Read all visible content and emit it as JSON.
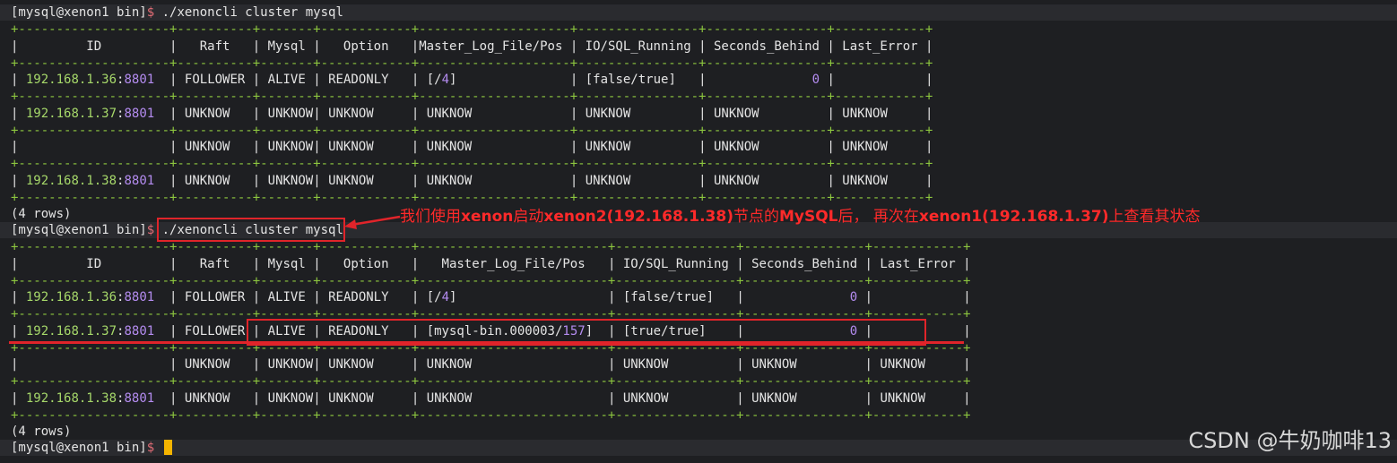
{
  "prompt": {
    "user_host": "[mysql@xenon1 bin]",
    "dollar": "$",
    "command": "./xenoncli cluster mysql"
  },
  "table1": {
    "separator": "+--------------------+----------+-------+------------+--------------------+----------------+----------------+------------+",
    "headers": [
      "ID",
      "Raft",
      "Mysql",
      "Option",
      "Master_Log_File/Pos",
      "IO/SQL_Running",
      "Seconds_Behind",
      "Last_Error"
    ],
    "rows": [
      {
        "ip": "192.168.1.36",
        "port": "8801",
        "raft": "FOLLOWER",
        "mysql": "ALIVE",
        "option": "READONLY",
        "pos_file": "",
        "pos_num": "4",
        "io_sql": "false/true",
        "seconds": "0",
        "last_error": ""
      },
      {
        "ip": "192.168.1.37",
        "port": "8801",
        "raft": "UNKNOW",
        "mysql": "UNKNOW",
        "option": "UNKNOW",
        "pos": "UNKNOW",
        "io_sql": "UNKNOW",
        "seconds": "UNKNOW",
        "last_error": "UNKNOW"
      },
      {
        "ip": "",
        "port": "",
        "raft": "UNKNOW",
        "mysql": "UNKNOW",
        "option": "UNKNOW",
        "pos": "UNKNOW",
        "io_sql": "UNKNOW",
        "seconds": "UNKNOW",
        "last_error": "UNKNOW"
      },
      {
        "ip": "192.168.1.38",
        "port": "8801",
        "raft": "UNKNOW",
        "mysql": "UNKNOW",
        "option": "UNKNOW",
        "pos": "UNKNOW",
        "io_sql": "UNKNOW",
        "seconds": "UNKNOW",
        "last_error": "UNKNOW"
      }
    ],
    "row_count": "(4 rows)"
  },
  "table2": {
    "separator": "+--------------------+----------+-------+------------+-------------------------+----------------+----------------+------------+",
    "headers": [
      "ID",
      "Raft",
      "Mysql",
      "Option",
      "Master_Log_File/Pos",
      "IO/SQL_Running",
      "Seconds_Behind",
      "Last_Error"
    ],
    "rows": [
      {
        "ip": "192.168.1.36",
        "port": "8801",
        "raft": "FOLLOWER",
        "mysql": "ALIVE",
        "option": "READONLY",
        "pos_file": "",
        "pos_num": "4",
        "io_sql": "false/true",
        "seconds": "0",
        "last_error": ""
      },
      {
        "ip": "192.168.1.37",
        "port": "8801",
        "raft": "FOLLOWER",
        "mysql": "ALIVE",
        "option": "READONLY",
        "pos_file": "mysql-bin.000003",
        "pos_num": "157",
        "io_sql": "true/true",
        "seconds": "0",
        "last_error": ""
      },
      {
        "ip": "",
        "port": "",
        "raft": "UNKNOW",
        "mysql": "UNKNOW",
        "option": "UNKNOW",
        "pos": "UNKNOW",
        "io_sql": "UNKNOW",
        "seconds": "UNKNOW",
        "last_error": "UNKNOW"
      },
      {
        "ip": "192.168.1.38",
        "port": "8801",
        "raft": "UNKNOW",
        "mysql": "UNKNOW",
        "option": "UNKNOW",
        "pos": "UNKNOW",
        "io_sql": "UNKNOW",
        "seconds": "UNKNOW",
        "last_error": "UNKNOW"
      }
    ],
    "row_count": "(4 rows)"
  },
  "annotation": {
    "p1": "我们使用",
    "b1": "xenon",
    "p2": "启动",
    "b2": "xenon2(192.168.1.38)",
    "p3": "节点的",
    "b3": "MySQL",
    "p4": "后， 再次在",
    "b4": "xenon1(192.168.1.37)",
    "p5": "上查看其状态"
  },
  "watermark": "CSDN @牛奶咖啡13",
  "colors": {
    "background": "#1e1f22",
    "separator": "#8dc63f",
    "ip": "#a6d86a",
    "port": "#b48cf0",
    "annotation": "#ff2a2a"
  }
}
